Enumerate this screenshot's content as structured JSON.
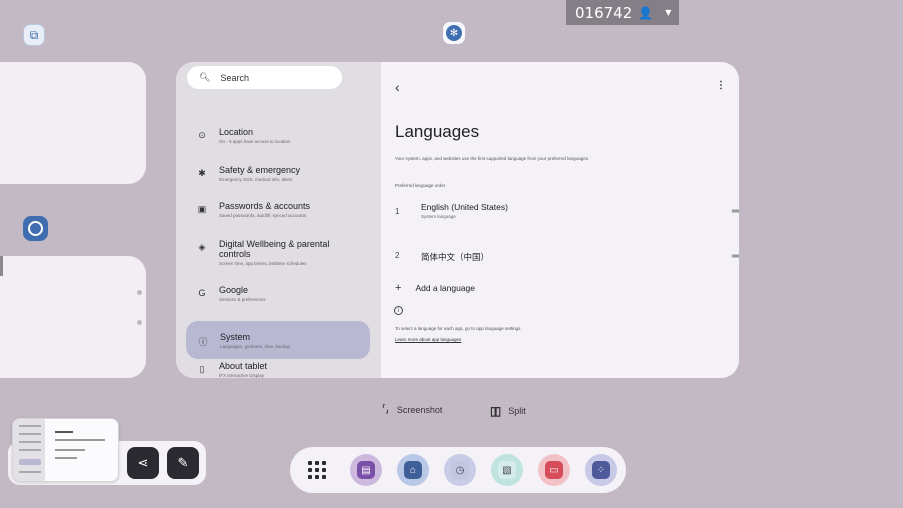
{
  "status_bar": {
    "id_text": "016742",
    "user_icon": "user-icon",
    "chevron": "▼"
  },
  "search": {
    "placeholder": "Search"
  },
  "settings_menu": [
    {
      "title": "Location",
      "subtitle": "On - 9 apps have access to location",
      "icon": "location-icon",
      "glyph": "⊙"
    },
    {
      "title": "Safety & emergency",
      "subtitle": "Emergency SOS, medical info, alerts",
      "icon": "asterisk-icon",
      "glyph": "✱"
    },
    {
      "title": "Passwords & accounts",
      "subtitle": "Saved passwords, autofill, synced accounts",
      "icon": "passwords-icon",
      "glyph": "▣"
    },
    {
      "title": "Digital Wellbeing & parental controls",
      "subtitle": "Screen time, app timers, bedtime schedules",
      "icon": "wellbeing-icon",
      "glyph": "◈"
    },
    {
      "title": "Google",
      "subtitle": "Services & preferences",
      "icon": "google-icon",
      "glyph": "G"
    },
    {
      "title": "System",
      "subtitle": "Languages, gestures, time, backup",
      "icon": "system-info-icon",
      "glyph": "ⓘ",
      "selected": true
    },
    {
      "title": "About tablet",
      "subtitle": "IFX Interactive Display",
      "icon": "tablet-icon",
      "glyph": "▯"
    }
  ],
  "languages_page": {
    "back": "‹",
    "more": "⋮",
    "title": "Languages",
    "description": "Your system, apps, and websites use the first supported language from your preferred languages.",
    "section_label": "Preferred language order",
    "languages": [
      {
        "num": "1",
        "name": "English (United States)",
        "sub": "System language"
      },
      {
        "num": "2",
        "name": "简体中文（中国）",
        "sub": ""
      }
    ],
    "drag_glyph": "═",
    "add_language": "Add a language",
    "info_text": "To select a language for each app, go to app language settings.",
    "info_link": "Learn more about app languages"
  },
  "actions": {
    "screenshot": "Screenshot",
    "split": "Split"
  },
  "colors": {
    "background": "#c3b9c5",
    "accent": "#3e6db0",
    "selected_item": "#b9b8d3",
    "dark_button": "#2c2a31"
  },
  "dock": {
    "apps": [
      {
        "name": "notes-app-icon",
        "ring": "#cdb9de",
        "fill": "#7a4fa8",
        "glyph": "▤"
      },
      {
        "name": "store-app-icon",
        "ring": "#b9c8e6",
        "fill": "#3f5f98",
        "glyph": "⌂"
      },
      {
        "name": "clock-app-icon",
        "ring": "#c9cce6",
        "fill": "#c3c6e0",
        "glyph": "◷"
      },
      {
        "name": "gallery-app-icon",
        "ring": "#bfe3de",
        "fill": "#d6ece8",
        "glyph": "▧"
      },
      {
        "name": "whiteboard-app-icon",
        "ring": "#f2c2c6",
        "fill": "#d64c5b",
        "glyph": "▭"
      },
      {
        "name": "more-apps-icon",
        "ring": "#c7c9e6",
        "fill": "#4e5a9a",
        "glyph": "⁘"
      }
    ]
  }
}
